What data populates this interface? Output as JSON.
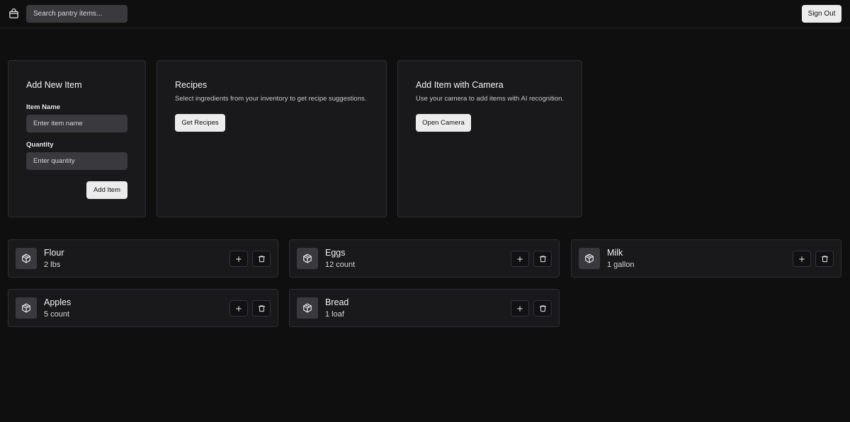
{
  "header": {
    "app_icon": "box-icon",
    "search_placeholder": "Search pantry items...",
    "signout_label": "Sign Out"
  },
  "add_item": {
    "title": "Add New Item",
    "name_label": "Item Name",
    "name_placeholder": "Enter item name",
    "quantity_label": "Quantity",
    "quantity_placeholder": "Enter quantity",
    "submit_label": "Add Item"
  },
  "recipes": {
    "title": "Recipes",
    "description": "Select ingredients from your inventory to get recipe suggestions.",
    "button_label": "Get Recipes"
  },
  "camera": {
    "title": "Add Item with Camera",
    "description": "Use your camera to add items with AI recognition.",
    "button_label": "Open Camera"
  },
  "items": [
    {
      "name": "Flour",
      "quantity": "2 lbs",
      "icon": "package-icon"
    },
    {
      "name": "Eggs",
      "quantity": "12 count",
      "icon": "package-icon"
    },
    {
      "name": "Milk",
      "quantity": "1 gallon",
      "icon": "package-icon"
    },
    {
      "name": "Apples",
      "quantity": "5 count",
      "icon": "package-icon"
    },
    {
      "name": "Bread",
      "quantity": "1 loaf",
      "icon": "package-icon"
    }
  ]
}
